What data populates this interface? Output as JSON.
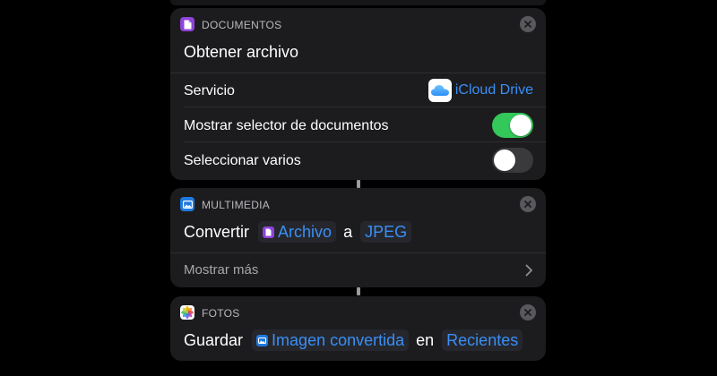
{
  "accent_color": "#3a8ff5",
  "toggle_on_color": "#34c759",
  "card_get_file": {
    "category": "DOCUMENTOS",
    "category_icon": "document-icon",
    "title": "Obtener archivo",
    "service_label": "Servicio",
    "service_value": "iCloud Drive",
    "service_icon": "icloud-icon",
    "show_picker_label": "Mostrar selector de documentos",
    "show_picker_on": true,
    "select_multiple_label": "Seleccionar varios",
    "select_multiple_on": false
  },
  "card_convert": {
    "category": "MULTIMEDIA",
    "category_icon": "media-icon",
    "verb": "Convertir",
    "variable": "Archivo",
    "variable_icon": "document-icon",
    "connector_word": "a",
    "format": "JPEG",
    "show_more_label": "Mostrar más"
  },
  "card_save": {
    "category": "FOTOS",
    "category_icon": "photos-icon",
    "verb": "Guardar",
    "variable": "Imagen convertida",
    "variable_icon": "media-icon",
    "connector_word": "en",
    "album": "Recientes"
  }
}
